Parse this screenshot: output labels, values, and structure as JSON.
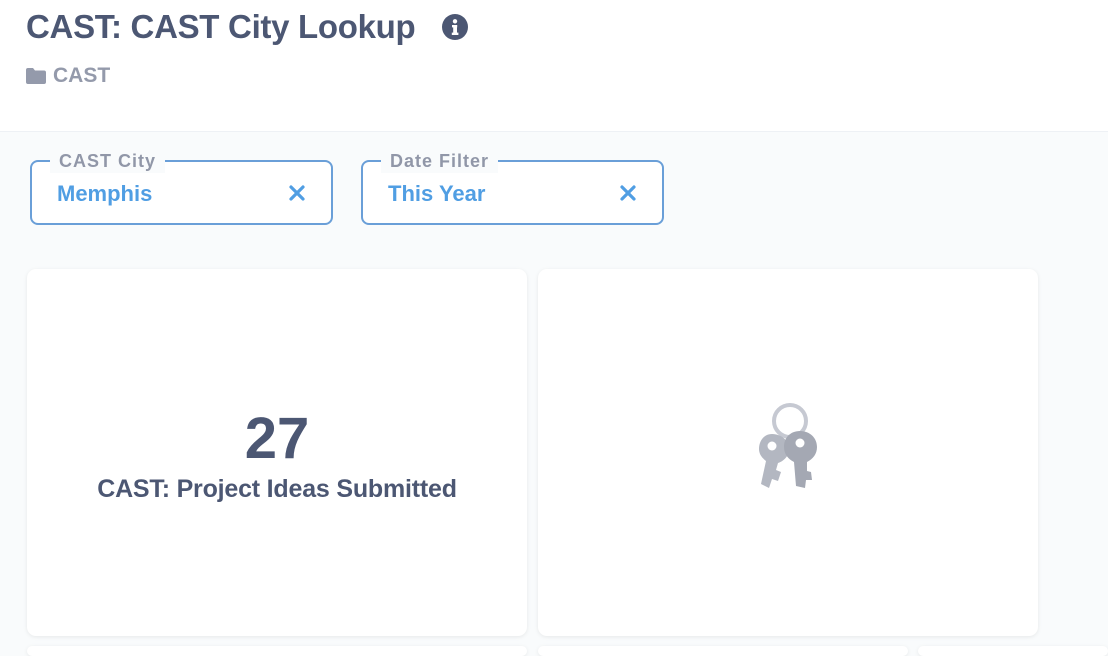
{
  "dashboard": {
    "title": "CAST: CAST City Lookup",
    "collection": "CAST"
  },
  "filters": [
    {
      "label": "CAST City",
      "value": "Memphis"
    },
    {
      "label": "Date Filter",
      "value": "This Year"
    }
  ],
  "cards": [
    {
      "value": "27",
      "title": "CAST: Project Ideas Submitted"
    },
    {
      "state": "no-permission",
      "icon": "keys-icon"
    }
  ],
  "colors": {
    "title": "#4c5773",
    "accent": "#509ee3",
    "filter_border": "#6a9fd8",
    "muted": "#949aab",
    "background": "#f9fbfc"
  }
}
